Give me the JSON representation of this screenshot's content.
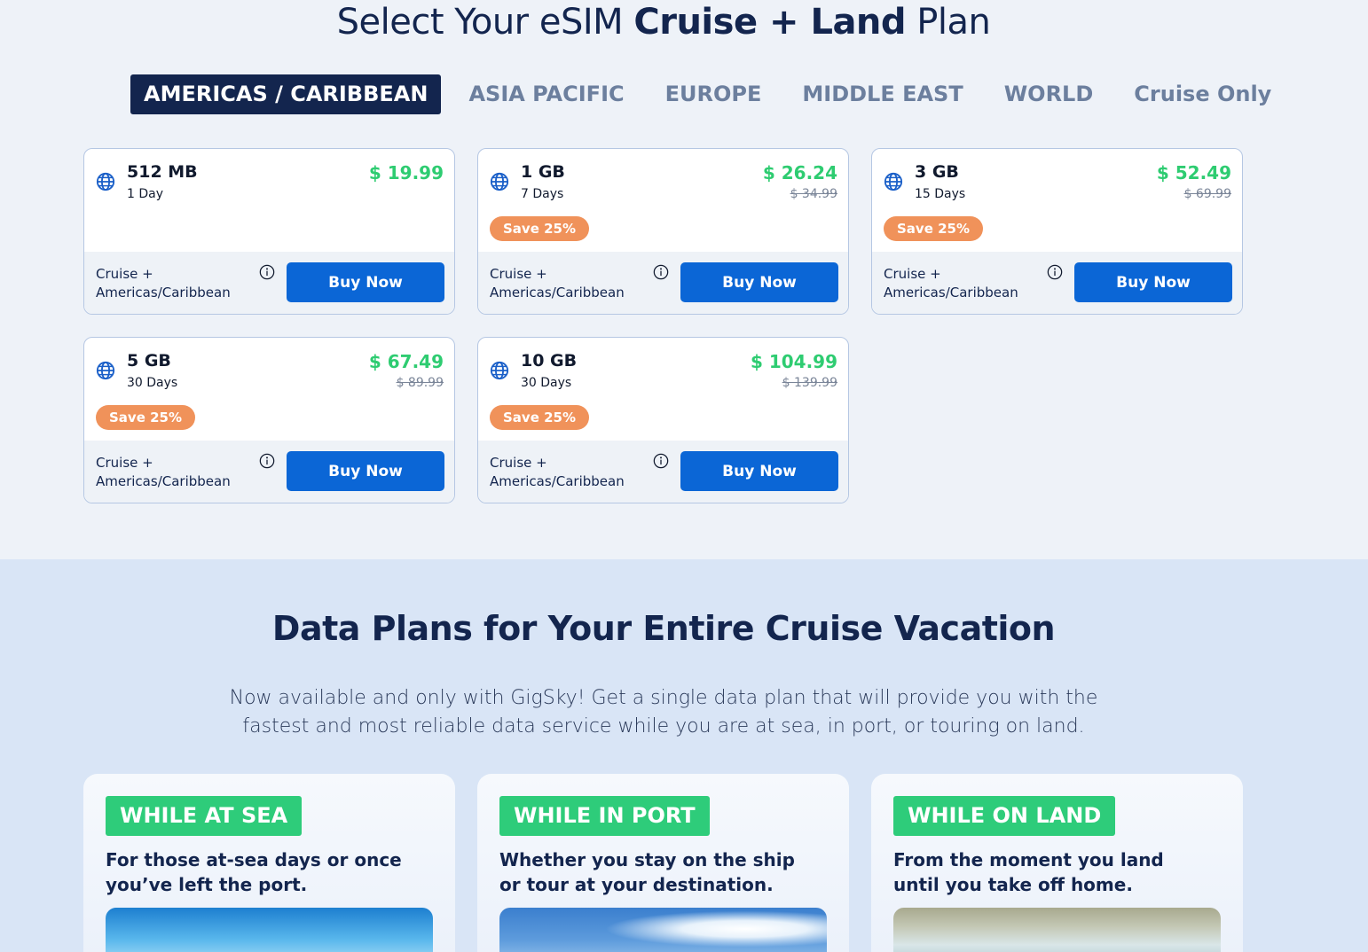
{
  "header": {
    "title_prefix": "Select Your eSIM ",
    "title_bold": "Cruise + Land",
    "title_suffix": " Plan"
  },
  "tabs": [
    {
      "label": "AMERICAS / CARIBBEAN",
      "active": true
    },
    {
      "label": "ASIA PACIFIC",
      "active": false
    },
    {
      "label": "EUROPE",
      "active": false
    },
    {
      "label": "MIDDLE EAST",
      "active": false
    },
    {
      "label": "WORLD",
      "active": false
    },
    {
      "label": "Cruise Only",
      "active": false
    }
  ],
  "plans": [
    {
      "data": "512 MB",
      "days": "1 Day",
      "price": "$ 19.99",
      "old_price": "",
      "badge": "",
      "region_line1": "Cruise +",
      "region_line2": "Americas/Caribbean",
      "button": "Buy Now"
    },
    {
      "data": "1 GB",
      "days": "7 Days",
      "price": "$ 26.24",
      "old_price": "$ 34.99",
      "badge": "Save 25%",
      "region_line1": "Cruise +",
      "region_line2": "Americas/Caribbean",
      "button": "Buy Now"
    },
    {
      "data": "3 GB",
      "days": "15 Days",
      "price": "$ 52.49",
      "old_price": "$ 69.99",
      "badge": "Save 25%",
      "region_line1": "Cruise +",
      "region_line2": "Americas/Caribbean",
      "button": "Buy Now"
    },
    {
      "data": "5 GB",
      "days": "30 Days",
      "price": "$ 67.49",
      "old_price": "$ 89.99",
      "badge": "Save 25%",
      "region_line1": "Cruise +",
      "region_line2": "Americas/Caribbean",
      "button": "Buy Now"
    },
    {
      "data": "10 GB",
      "days": "30 Days",
      "price": "$ 104.99",
      "old_price": "$ 139.99",
      "badge": "Save 25%",
      "region_line1": "Cruise +",
      "region_line2": "Americas/Caribbean",
      "button": "Buy Now"
    }
  ],
  "section": {
    "title": "Data Plans for Your Entire Cruise Vacation",
    "description_line1": "Now available and only with GigSky! Get a single data plan that will provide you with the",
    "description_line2": "fastest  and most reliable data service while you are at sea, in port, or touring on land."
  },
  "features": [
    {
      "label": "WHILE AT SEA",
      "description": "For those at-sea days or once you’ve left the port."
    },
    {
      "label": "WHILE IN PORT",
      "description": "Whether you stay on the ship or tour at your destination."
    },
    {
      "label": "WHILE ON LAND",
      "description": "From the moment you land until you take off home."
    }
  ],
  "colors": {
    "navy": "#13254e",
    "price_green": "#2ecc71",
    "badge_orange": "#f0925a",
    "button_blue": "#0b66d6",
    "pill_green": "#2ecc7a"
  },
  "icons": {
    "plan": "globe-icon",
    "region": "info-icon"
  }
}
